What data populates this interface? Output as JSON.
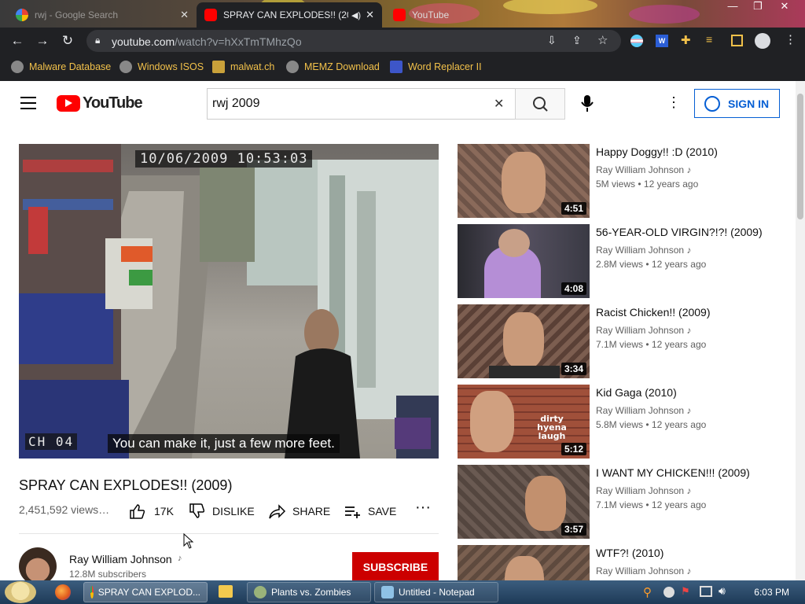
{
  "browser": {
    "tabs": [
      {
        "title": "Google Search",
        "prefix": "rwj - "
      },
      {
        "title": "SPRAY CAN EXPLODES!! (200",
        "muted_icon": "speaker-icon"
      },
      {
        "title": "YouTube"
      }
    ],
    "url_host": "youtube.com",
    "url_path": "/watch?v=hXxTmTMhzQo",
    "bookmarks": [
      "Malware Database",
      "Windows ISOS",
      "malwat.ch",
      "MEMZ Download",
      "Word Replacer II"
    ],
    "colors": {
      "chrome_dark": "#202124",
      "bookmark_text": "#f2c14a"
    }
  },
  "youtube": {
    "logo_text": "YouTube",
    "search_value": "rwj 2009",
    "signin_label": "SIGN IN",
    "colors": {
      "brand_red": "#ff0000",
      "link_blue": "#065fd4",
      "subscribe": "#cc0000"
    }
  },
  "video": {
    "osd_timestamp": "10/06/2009 10:53:03",
    "osd_channel": "CH 04",
    "caption": "You can make it, just a few more feet.",
    "title": "SPRAY CAN EXPLODES!! (2009)",
    "views": "2,451,592 views…",
    "likes": "17K",
    "dislike_label": "DISLIKE",
    "share_label": "SHARE",
    "save_label": "SAVE",
    "channel_name": "Ray William Johnson",
    "subscribers": "12.8M subscribers",
    "subscribe_label": "SUBSCRIBE"
  },
  "suggestions": [
    {
      "title": "Happy Doggy!! :D (2010)",
      "channel": "Ray William Johnson",
      "views": "5M views",
      "age": "12 years ago",
      "duration": "4:51"
    },
    {
      "title": "56-YEAR-OLD VIRGIN?!?! (2009)",
      "channel": "Ray William Johnson",
      "views": "2.8M views",
      "age": "12 years ago",
      "duration": "4:08"
    },
    {
      "title": "Racist Chicken!! (2009)",
      "channel": "Ray William Johnson",
      "views": "7.1M views",
      "age": "12 years ago",
      "duration": "3:34"
    },
    {
      "title": "Kid Gaga (2010)",
      "channel": "Ray William Johnson",
      "views": "5.8M views",
      "age": "12 years ago",
      "duration": "5:12",
      "thumb_text": "dirty hyena laugh"
    },
    {
      "title": "I WANT MY CHICKEN!!! (2009)",
      "channel": "Ray William Johnson",
      "views": "7.1M views",
      "age": "12 years ago",
      "duration": "3:57"
    },
    {
      "title": "WTF?! (2010)",
      "channel": "Ray William Johnson",
      "views": "",
      "age": "",
      "duration": ""
    }
  ],
  "taskbar": {
    "items": [
      "SPRAY CAN EXPLOD...",
      "Plants vs. Zombies",
      "Untitled - Notepad"
    ],
    "clock": "6:03 PM"
  }
}
